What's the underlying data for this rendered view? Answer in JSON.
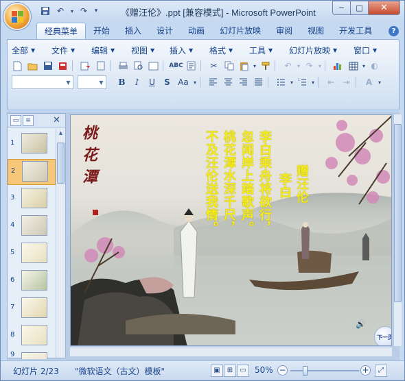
{
  "window": {
    "title": "《赠汪伦》.ppt [兼容模式] - Microsoft PowerPoint",
    "minimize": "−",
    "maximize": "□",
    "close": "✕"
  },
  "quick_access": [
    {
      "icon": "save-icon",
      "glyph": "💾"
    },
    {
      "icon": "undo-icon",
      "glyph": "↶"
    },
    {
      "icon": "undo-dropdown-icon",
      "glyph": "▾"
    },
    {
      "icon": "redo-icon",
      "glyph": "↷"
    },
    {
      "icon": "customize-icon",
      "glyph": "▾"
    }
  ],
  "tabs": [
    "经典菜单",
    "开始",
    "插入",
    "设计",
    "动画",
    "幻灯片放映",
    "审阅",
    "视图",
    "开发工具"
  ],
  "active_tab": "经典菜单",
  "help": "?",
  "menus": [
    "全部",
    "文件",
    "编辑",
    "视图",
    "插入",
    "格式",
    "工具",
    "幻灯片放映",
    "窗口"
  ],
  "formatting": {
    "bold": "B",
    "italic": "I",
    "underline": "U",
    "strike": "S",
    "case": "Aa",
    "fontcolor": "A"
  },
  "slide_pane": {
    "slides": [
      "1",
      "2",
      "3",
      "4",
      "5",
      "6",
      "7",
      "8",
      "9"
    ],
    "selected": "2"
  },
  "slide": {
    "title_poem": "赠汪伦",
    "author": "李白",
    "lines": [
      "李白乘舟将欲行，",
      "忽闻岸上踏歌声。",
      "桃花潭水深千尺，",
      "不及汪伦送我情。"
    ],
    "calligraphy": "桃花潭",
    "next_button": "下一页"
  },
  "status": {
    "slide_info": "幻灯片 2/23",
    "theme": "\"微软语文（古文）模板\"",
    "zoom": "50%"
  },
  "colors": {
    "poem_text": "#f4ec1c",
    "ribbon_bg": "#dae6f4",
    "accent": "#15428b"
  }
}
